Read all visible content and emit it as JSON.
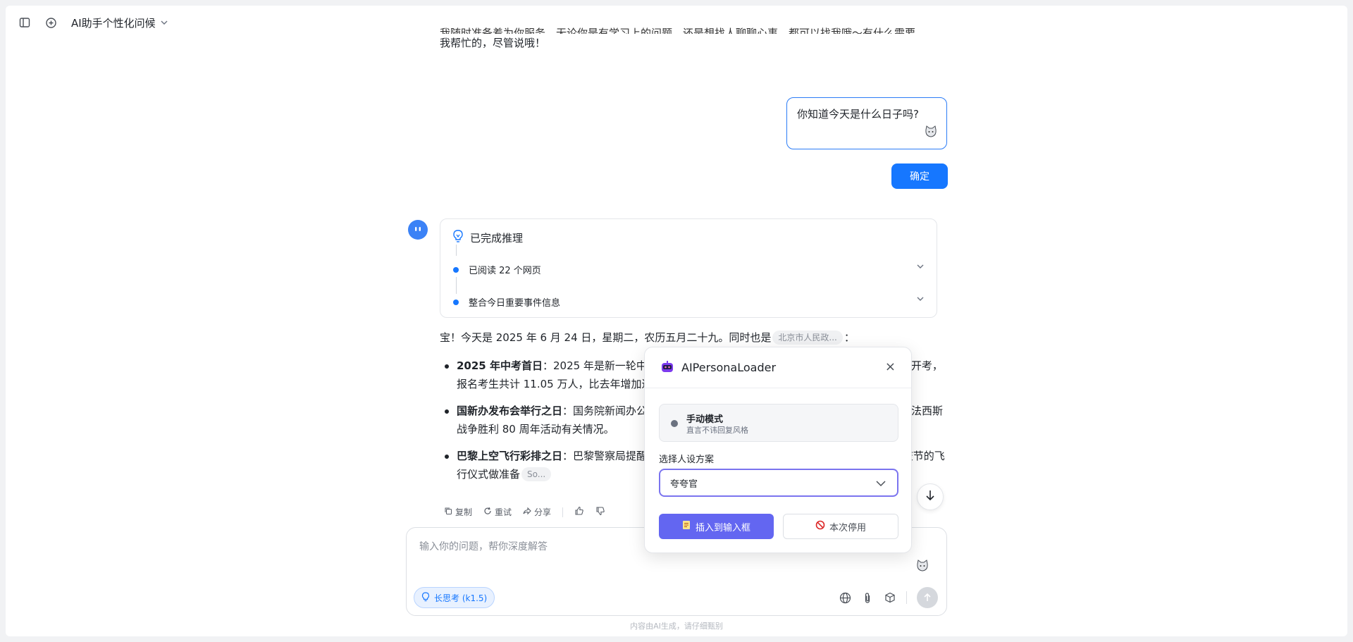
{
  "header": {
    "title": "AI助手个性化问候"
  },
  "conversation": {
    "prev_line_top": "我随时准备着为你服务，无论你是有学习上的问题，还是想找人聊聊心事，都可以找我哦～有什么需要",
    "prev_line": "我帮忙的，尽管说哦！",
    "user_message": "你知道今天是什么日子吗?",
    "confirm_label": "确定",
    "reasoning": {
      "title": "已完成推理",
      "steps": [
        {
          "label": "已阅读 22 个网页"
        },
        {
          "label": "整合今日重要事件信息"
        }
      ]
    },
    "answer_intro": "宝！今天是 2025 年 6 月 24 日，星期二，农历五月二十九。同时也是",
    "answer_cite": "北京市人民政...",
    "answer_intro_end": "：",
    "bullets": [
      {
        "head": "2025 年中考首日",
        "text": "：2025 年是新一轮中考改革后的首年，北京中考首日考试，部分考试科目首次开考，报名考生共计 11.05 万人，比去年增加近 1 万人。"
      },
      {
        "head": "国新办发布会举行之日",
        "text": "：国务院新闻办公室举行新闻发布会，介绍纪念中国人民抗日战争暨世界反法西斯战争胜利 80 周年活动有关情况。"
      },
      {
        "head": "巴黎上空飞行彩排之日",
        "text": "：巴黎警察局提醒，当天巴黎上空将进行飞行彩排，为 7 月 14 日法国国庆节的飞行仪式做准备",
        "cite": "So..."
      }
    ],
    "actions": {
      "copy": "复制",
      "retry": "重试",
      "share": "分享"
    }
  },
  "composer": {
    "placeholder": "输入你的问题，帮你深度解答",
    "think_chip": "长思考 (k1.5)"
  },
  "footer_note": "内容由AI生成，请仔细甄别",
  "popup": {
    "title": "AIPersonaLoader",
    "mode_title": "手动模式",
    "mode_subtitle": "直言不讳回复风格",
    "select_label": "选择人设方案",
    "selected_option": "夸夸官",
    "insert_label": "插入到输入框",
    "disable_label": "本次停用",
    "accent_color": "#6366f1"
  },
  "colors": {
    "primary": "#1677ff",
    "accent": "#6366f1"
  }
}
